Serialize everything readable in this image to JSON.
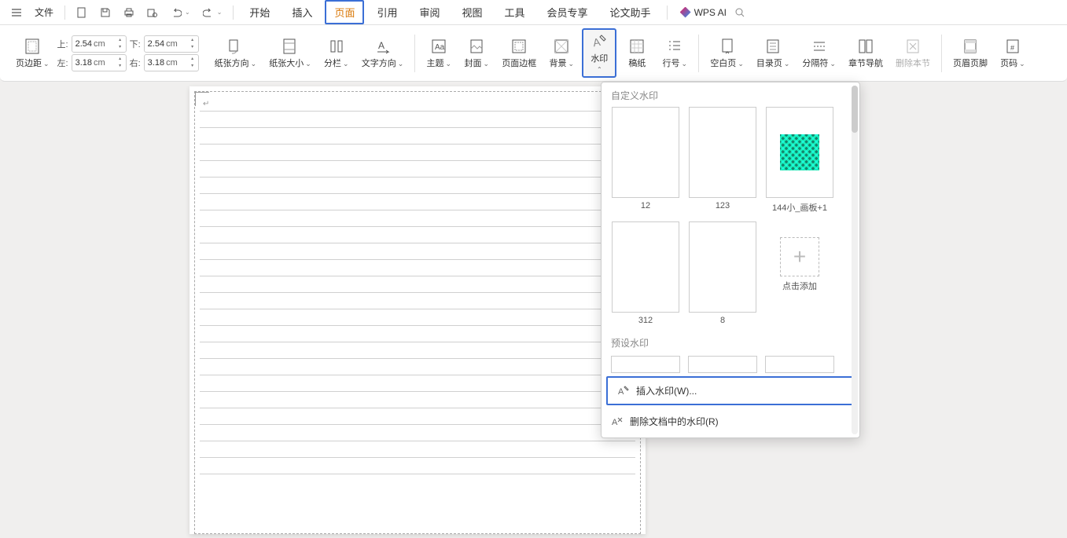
{
  "menubar": {
    "file": "文件",
    "tabs": [
      "开始",
      "插入",
      "页面",
      "引用",
      "审阅",
      "视图",
      "工具",
      "会员专享",
      "论文助手"
    ],
    "active_tab_index": 2,
    "wps_ai": "WPS AI"
  },
  "ribbon": {
    "page_margins_label": "页边距",
    "margins": {
      "top_label": "上:",
      "top": "2.54",
      "top_unit": "cm",
      "bottom_label": "下:",
      "bottom": "2.54",
      "bottom_unit": "cm",
      "left_label": "左:",
      "left": "3.18",
      "left_unit": "cm",
      "right_label": "右:",
      "right": "3.18",
      "right_unit": "cm"
    },
    "orientation": "纸张方向",
    "paper_size": "纸张大小",
    "columns": "分栏",
    "text_direction": "文字方向",
    "theme": "主题",
    "cover": "封面",
    "page_border": "页面边框",
    "background": "背景",
    "watermark": "水印",
    "manuscript": "稿纸",
    "line_number": "行号",
    "blank_page": "空白页",
    "toc_page": "目录页",
    "separator": "分隔符",
    "chapter_nav": "章节导航",
    "delete_section": "删除本节",
    "header_footer": "页眉页脚",
    "page_number": "页码"
  },
  "dropdown": {
    "custom_title": "自定义水印",
    "preset_title": "预设水印",
    "custom_items": [
      {
        "label": "12"
      },
      {
        "label": "123"
      },
      {
        "label": "144小_画板+1"
      },
      {
        "label": "312"
      },
      {
        "label": "8"
      }
    ],
    "add_label": "点击添加",
    "insert_watermark": "插入水印(W)...",
    "remove_watermark": "删除文档中的水印(R)"
  }
}
